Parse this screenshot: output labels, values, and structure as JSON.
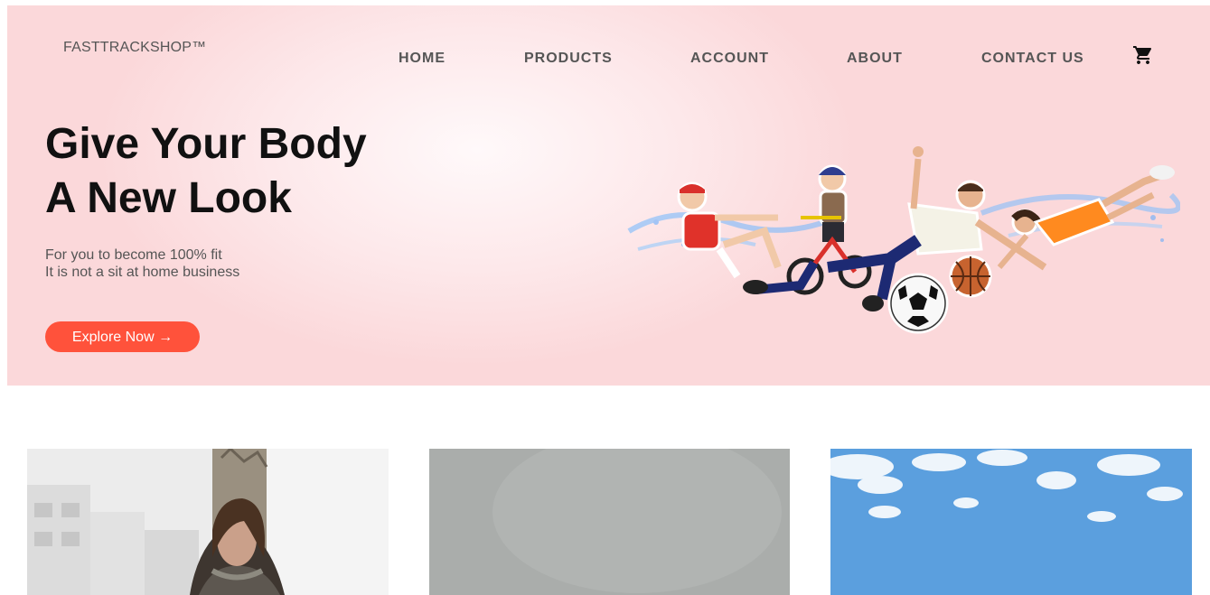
{
  "brand": {
    "logo_text": "FASTTRACKSHOP™",
    "accent_color": "#ff523b",
    "hero_bg_color": "#fbd8da"
  },
  "nav": {
    "items": [
      {
        "label": "HOME"
      },
      {
        "label": "PRODUCTS"
      },
      {
        "label": "ACCOUNT"
      },
      {
        "label": "ABOUT"
      },
      {
        "label": "CONTACT US"
      }
    ],
    "cart_icon": "shopping-cart-icon"
  },
  "hero": {
    "headline_line1": "Give Your Body",
    "headline_line2": "A New Look",
    "subtext_line1": "For you to become 100% fit",
    "subtext_line2": "It is not a sit at home business",
    "cta_label": "Explore Now →",
    "image": "kids-sports-collage"
  },
  "gallery": {
    "cards": [
      {
        "image": "woman-portrait-street"
      },
      {
        "image": "gray-backdrop"
      },
      {
        "image": "blue-sky-clouds"
      }
    ]
  }
}
